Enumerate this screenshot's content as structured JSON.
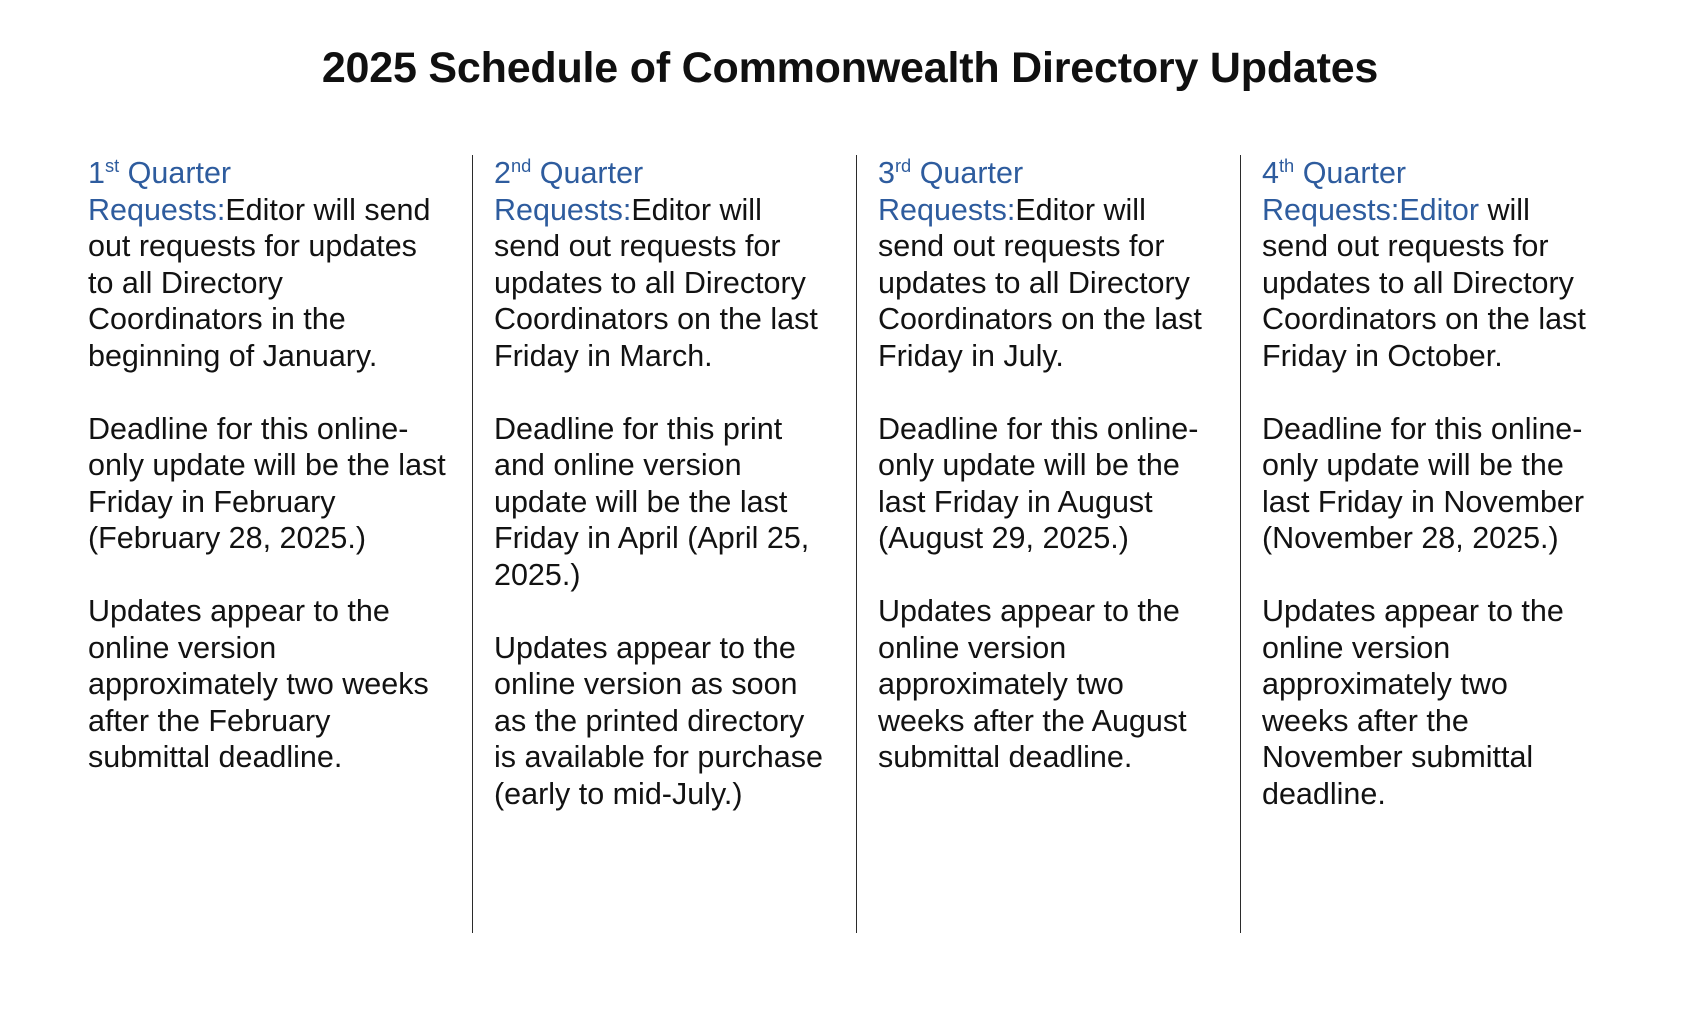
{
  "document": {
    "title": "2025 Schedule of Commonwealth Directory Updates",
    "accent_color": "#2e5c9e",
    "text_color": "#121212"
  },
  "columns": [
    {
      "heading_number": "1",
      "heading_ordinal": "st",
      "heading_rest": " Quarter Requests:",
      "para1_lead": "Editor",
      "para1_rest": " will send out requests for updates to all Directory Coordinators in the beginning of January.",
      "para1_lead_blue": false,
      "para2": "Deadline for this online-only update will be the last Friday in February (February 28, 2025.)",
      "para3": "Updates appear to the online version approximately two weeks after the February submittal deadline."
    },
    {
      "heading_number": "2",
      "heading_ordinal": "nd",
      "heading_rest": " Quarter Requests:",
      "para1_lead": "Editor",
      "para1_rest": " will send out requests for updates to all Directory Coordinators on the last Friday in March.",
      "para1_lead_blue": false,
      "para2": "Deadline for this print and online version update will be the last Friday in April (April 25, 2025.)",
      "para3": "Updates appear to the online version as soon as the printed directory is available for purchase (early to mid-July.)"
    },
    {
      "heading_number": "3",
      "heading_ordinal": "rd",
      "heading_rest": " Quarter Requests:",
      "para1_lead": "Editor",
      "para1_rest": " will send out requests for updates to all Directory Coordinators on the last Friday in July.",
      "para1_lead_blue": false,
      "para2": "Deadline for this online-only update will be the last Friday in August (August 29, 2025.)",
      "para3": "Updates appear to the online version approximately two weeks after the August submittal deadline."
    },
    {
      "heading_number": "4",
      "heading_ordinal": "th",
      "heading_rest": " Quarter Requests:",
      "para1_lead": "Editor",
      "para1_rest": " will send out requests for updates to all Directory Coordinators on the last Friday in October.",
      "para1_lead_blue": true,
      "para2": "Deadline for this online-only update will be the last Friday in November (November 28, 2025.)",
      "para3": "Updates appear to the online version approximately two weeks after the November submittal deadline."
    }
  ]
}
